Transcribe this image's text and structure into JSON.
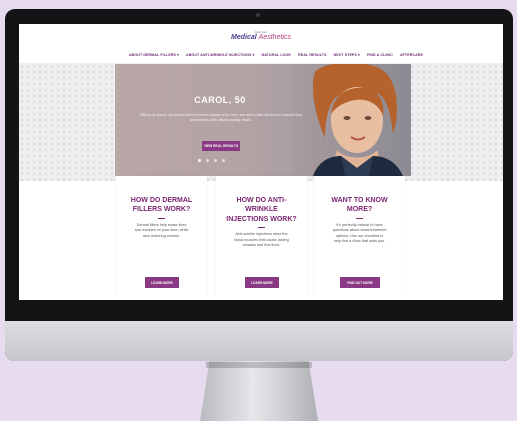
{
  "colors": {
    "brand": "#7a2670",
    "button": "#8a3a84",
    "background": "#e7dcef"
  },
  "header": {
    "logo_small": "Allergan",
    "logo_main": "Medical",
    "logo_accent": "Aesthetics"
  },
  "nav": {
    "items": [
      {
        "label": "ABOUT DERMAL FILLERS ▾"
      },
      {
        "label": "ABOUT ANTI-WRINKLE INJECTIONS ▾"
      },
      {
        "label": "NATURAL LOOK"
      },
      {
        "label": "REAL RESULTS"
      },
      {
        "label": "NEXT STEPS ▾"
      },
      {
        "label": "FIND A CLINIC"
      },
      {
        "label": "AFTERCARE"
      }
    ]
  },
  "hero": {
    "title": "CAROL, 50",
    "text": "Millions of women use dermal fillers to restore volume to the face, and anti-wrinkle injections to smooth lines and wrinkles, with natural-looking results.",
    "button_label": "VIEW REAL RESULTS",
    "slide_count": 4,
    "active_slide": 0
  },
  "cards": [
    {
      "title": "HOW DO DERMAL FILLERS WORK?",
      "text": "Dermal fillers help erase lines and wrinkles on your face, while also restoring volume.",
      "button_label": "LEARN MORE"
    },
    {
      "title": "HOW DO ANTI-WRINKLE INJECTIONS WORK?",
      "text": "Anti-wrinkle injections relax the facial muscles that cause lasting creases and fine lines.",
      "button_label": "LEARN MORE"
    },
    {
      "title": "WANT TO KNOW MORE?",
      "text": "It's perfectly natural to have questions about facial treatment options. Use our checklist to help find a clinic that suits you.",
      "button_label": "FIND OUT MORE"
    }
  ]
}
